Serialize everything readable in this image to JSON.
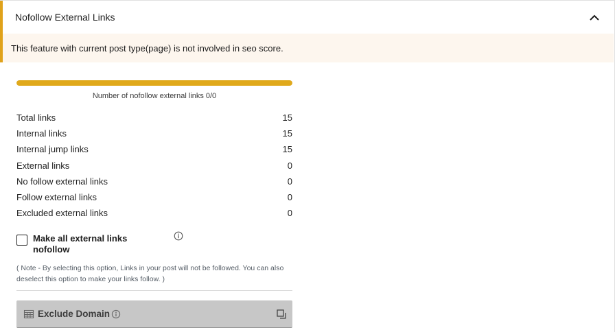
{
  "header": {
    "title": "Nofollow External Links",
    "toggle_icon": "chevron-up-icon",
    "accent_color": "#e0a21a"
  },
  "notice": {
    "text": "This feature with current post type(page) is not involved in seo score.",
    "background": "#fdf6ee"
  },
  "progress": {
    "label": "Number of nofollow external links 0/0",
    "fraction": 1.0,
    "color": "#e0a91b"
  },
  "stats": [
    {
      "label": "Total links",
      "value": "15"
    },
    {
      "label": "Internal links",
      "value": "15"
    },
    {
      "label": "Internal jump links",
      "value": "15"
    },
    {
      "label": "External links",
      "value": "0"
    },
    {
      "label": "No follow external links",
      "value": "0"
    },
    {
      "label": "Follow external links",
      "value": "0"
    },
    {
      "label": "Excluded external links",
      "value": "0"
    }
  ],
  "nofollow_option": {
    "label": "Make all external links nofollow",
    "checked": false,
    "info_icon": "info-icon",
    "note": "( Note - By selecting this option, Links in your post will not be followed. You can also deselect this option to make your links follow. )"
  },
  "exclude_domain": {
    "label": "Exclude Domain",
    "icon": "building-icon",
    "info_icon": "info-icon",
    "expand_icon": "expand-icon"
  }
}
